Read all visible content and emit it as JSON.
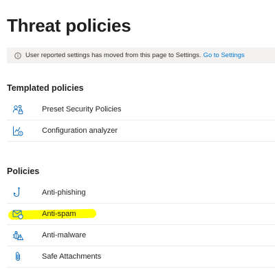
{
  "page": {
    "title": "Threat policies"
  },
  "info_bar": {
    "message": "User reported settings has moved from this page to Settings.",
    "link_text": "Go to Settings",
    "icon": "info-icon"
  },
  "templated": {
    "heading": "Templated policies",
    "items": [
      {
        "label": "Preset Security Policies",
        "icon": "people-lock-icon"
      },
      {
        "label": "Configuration analyzer",
        "icon": "chart-analyzer-icon"
      }
    ]
  },
  "policies": {
    "heading": "Policies",
    "items": [
      {
        "label": "Anti-phishing",
        "icon": "fish-hook-icon"
      },
      {
        "label": "Anti-spam",
        "icon": "mail-shield-icon",
        "highlighted": true
      },
      {
        "label": "Anti-malware",
        "icon": "bug-warning-icon"
      },
      {
        "label": "Safe Attachments",
        "icon": "paperclip-icon"
      }
    ]
  },
  "colors": {
    "link": "#0078d4",
    "info_bar_bg": "#f3f2f1",
    "icon": "#0f6cbd",
    "highlight": "#ffff00"
  }
}
